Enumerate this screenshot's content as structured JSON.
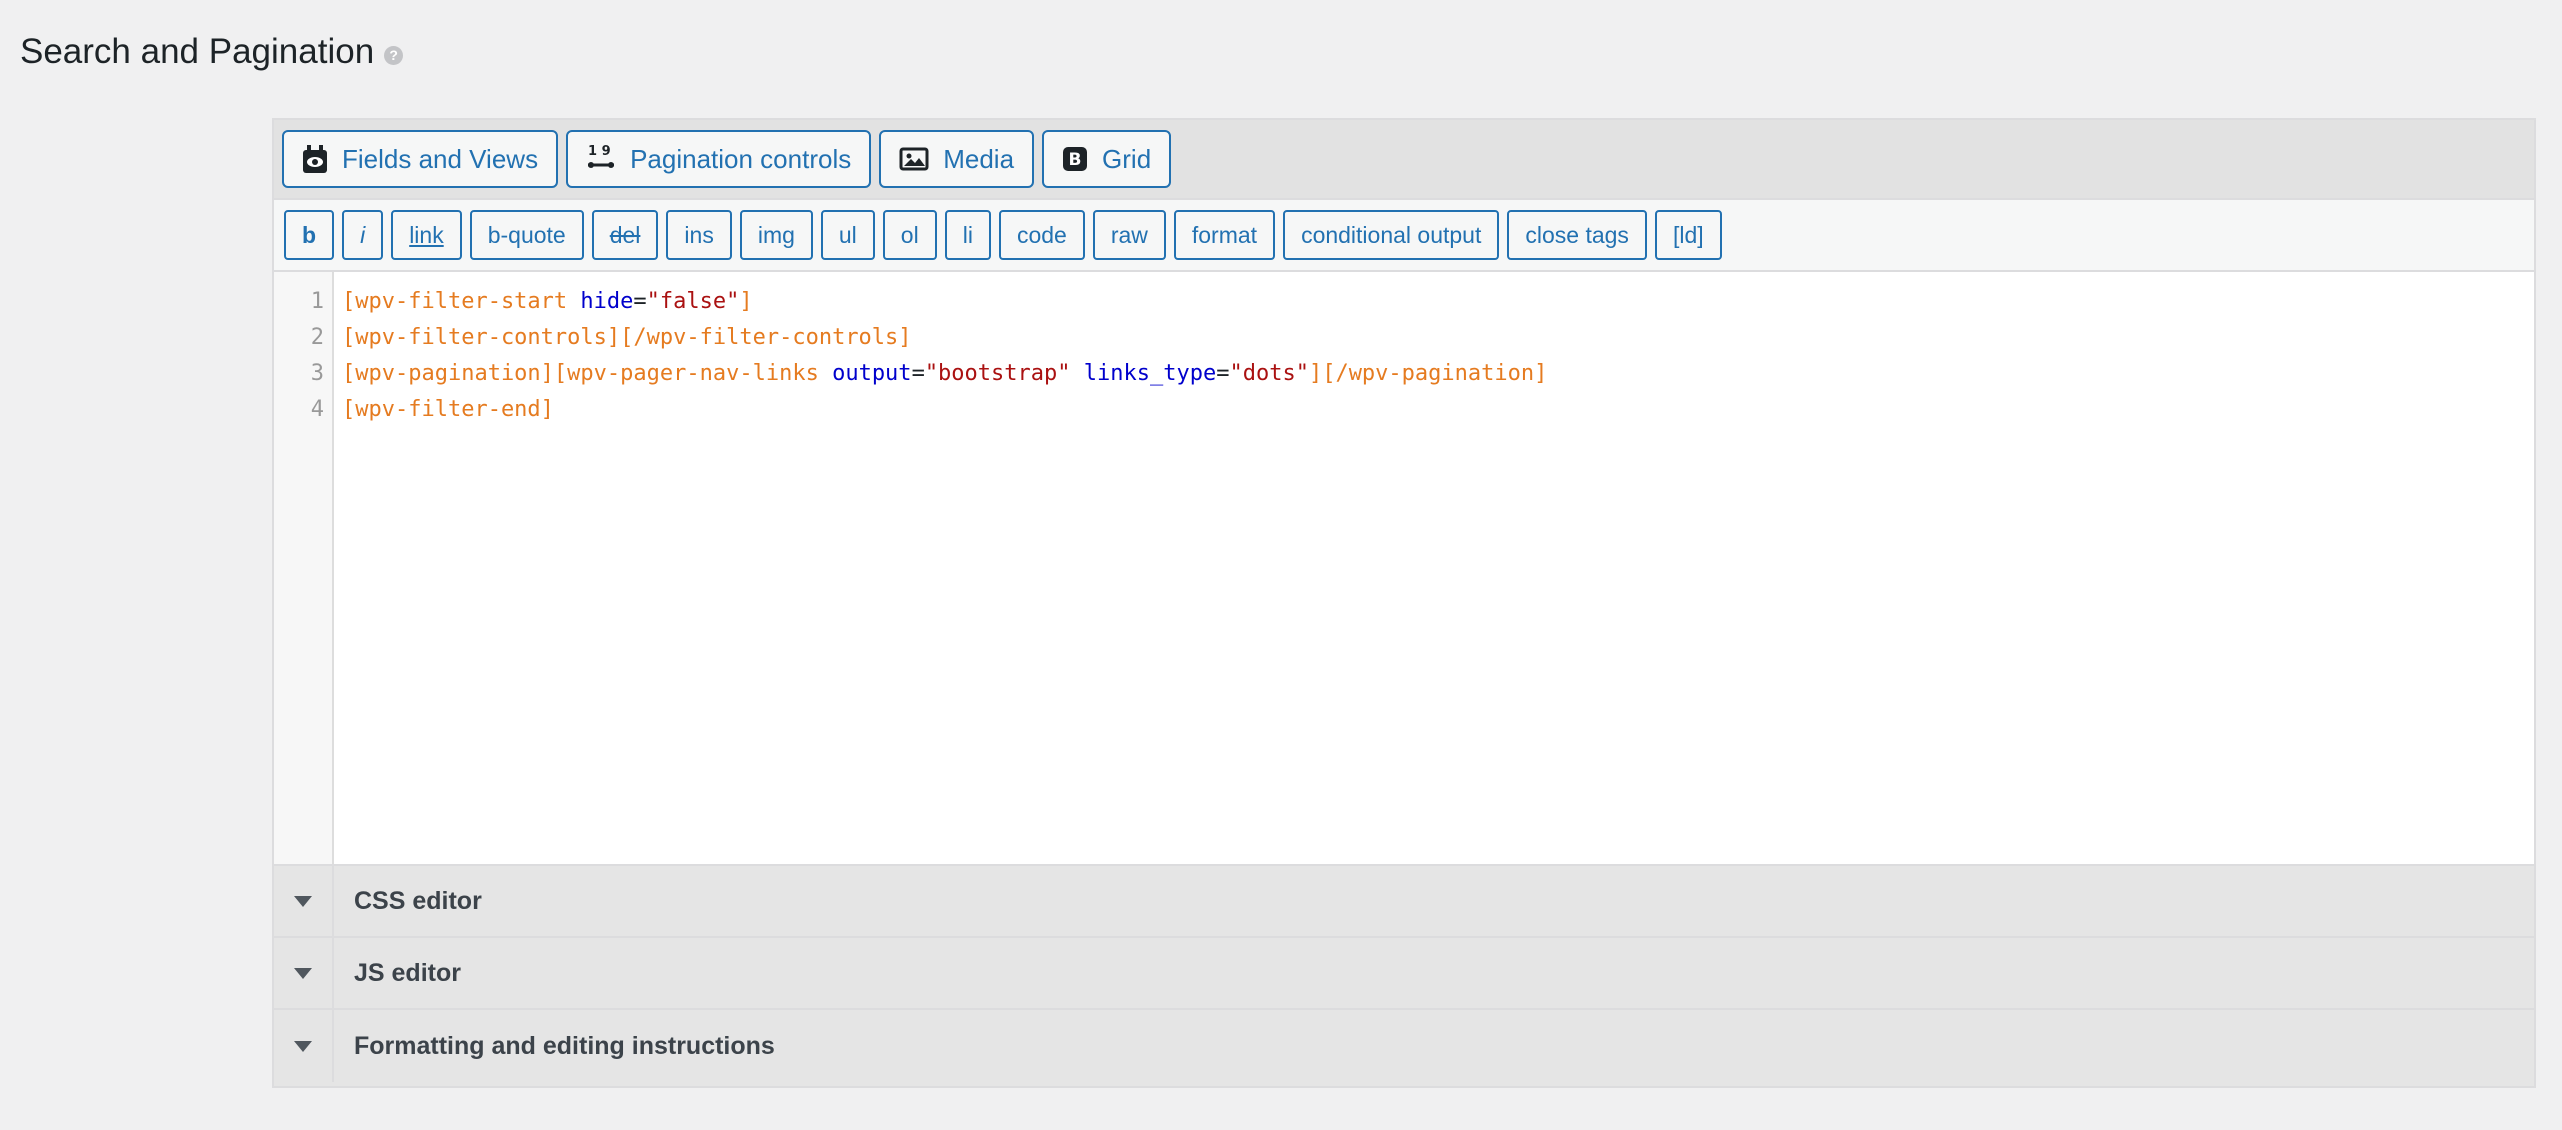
{
  "page": {
    "title": "Search and Pagination",
    "help_glyph": "?"
  },
  "toolbar": {
    "buttons": [
      {
        "label": "Fields and Views",
        "icon": "fields-views-icon"
      },
      {
        "label": "Pagination controls",
        "icon": "pagination-icon"
      },
      {
        "label": "Media",
        "icon": "image-icon"
      },
      {
        "label": "Grid",
        "icon": "bootstrap-icon"
      }
    ],
    "grid_icon_letter": "B",
    "pagination_icon_digits": "1 9"
  },
  "quicktags": [
    {
      "label": "b"
    },
    {
      "label": "i"
    },
    {
      "label": "link"
    },
    {
      "label": "b-quote"
    },
    {
      "label": "del"
    },
    {
      "label": "ins"
    },
    {
      "label": "img"
    },
    {
      "label": "ul"
    },
    {
      "label": "ol"
    },
    {
      "label": "li"
    },
    {
      "label": "code"
    },
    {
      "label": "raw"
    },
    {
      "label": "format"
    },
    {
      "label": "conditional output"
    },
    {
      "label": "close tags"
    },
    {
      "label": "[ld]"
    }
  ],
  "code": {
    "line_numbers": [
      "1",
      "2",
      "3",
      "4"
    ],
    "lines": [
      {
        "t1": "[wpv-filter-start",
        "t2": " ",
        "t3": "hide",
        "t4": "=",
        "t5": "\"false\"",
        "t6": "]"
      },
      {
        "t1": "[wpv-filter-controls][/wpv-filter-controls]"
      },
      {
        "t1": "[wpv-pagination][wpv-pager-nav-links",
        "t2": " ",
        "t3": "output",
        "t4": "=",
        "t5": "\"bootstrap\"",
        "t6": " ",
        "t7": "links_type",
        "t8": "=",
        "t9": "\"dots\"",
        "t10": "][/wpv-pagination]"
      },
      {
        "t1": "[wpv-filter-end]"
      }
    ]
  },
  "panels": [
    {
      "title": "CSS editor"
    },
    {
      "title": "JS editor"
    },
    {
      "title": "Formatting and editing instructions"
    }
  ],
  "colors": {
    "accent": "#2271b1",
    "tag": "#e57b20",
    "attr": "#0000cc",
    "string": "#aa1111"
  }
}
